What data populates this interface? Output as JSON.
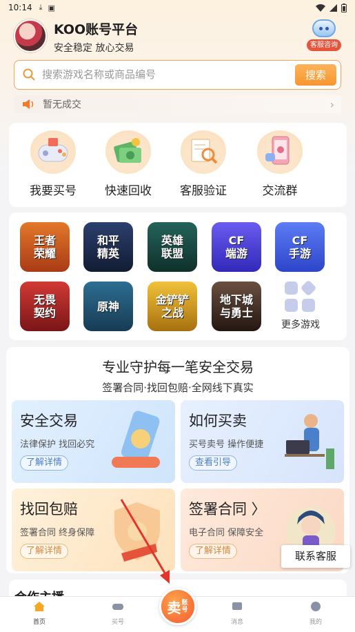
{
  "status_bar": {
    "time": "10:14"
  },
  "header": {
    "title": "KOO账号平台",
    "subtitle": "安全稳定 放心交易",
    "service_label": "客服咨询"
  },
  "search": {
    "placeholder": "搜索游戏名称或商品编号",
    "button": "搜索"
  },
  "notice": {
    "text": "暂无成交"
  },
  "quick_actions": [
    {
      "label": "我要买号",
      "icon": "gamepad-icon"
    },
    {
      "label": "快速回收",
      "icon": "money-icon"
    },
    {
      "label": "客服验证",
      "icon": "verify-icon"
    },
    {
      "label": "交流群",
      "icon": "chat-phone-icon"
    }
  ],
  "games": [
    {
      "name": "王者\n荣耀",
      "color": "#c4541e"
    },
    {
      "name": "和平\n精英",
      "color": "#1d2b4c"
    },
    {
      "name": "英雄\n联盟",
      "color": "#17453e"
    },
    {
      "name": "CF\n端游",
      "color": "#4b3ed6"
    },
    {
      "name": "CF\n手游",
      "color": "#3d5fe0"
    },
    {
      "name": "无畏\n契约",
      "color": "#b0262a"
    },
    {
      "name": "原神",
      "color": "#1f4d6b"
    },
    {
      "name": "金铲铲\n之战",
      "color": "#c7901c"
    },
    {
      "name": "地下城\n与勇士",
      "color": "#3a2a22"
    }
  ],
  "more_games": "更多游戏",
  "promo": {
    "title": "专业守护每一笔安全交易",
    "subtitle": "签署合同·找回包赔·全网线下真实",
    "tiles": [
      {
        "title": "安全交易",
        "desc": "法律保护 找回必究",
        "button": "了解详情"
      },
      {
        "title": "如何买卖",
        "desc": "买号卖号 操作便捷",
        "button": "查看引导"
      },
      {
        "title": "找回包赔",
        "desc": "签署合同 终身保障",
        "button": "了解详情"
      },
      {
        "title": "签署合同 〉",
        "desc": "电子合同 保障安全",
        "button": "了解详情"
      }
    ]
  },
  "contact_button": "联系客服",
  "partner_title": "合作主播",
  "tabbar": {
    "tabs": [
      {
        "label": "首页"
      },
      {
        "label": "买号"
      },
      {
        "label": "消息"
      },
      {
        "label": "我的"
      }
    ],
    "sell_main": "卖",
    "sell_small": "账号"
  }
}
